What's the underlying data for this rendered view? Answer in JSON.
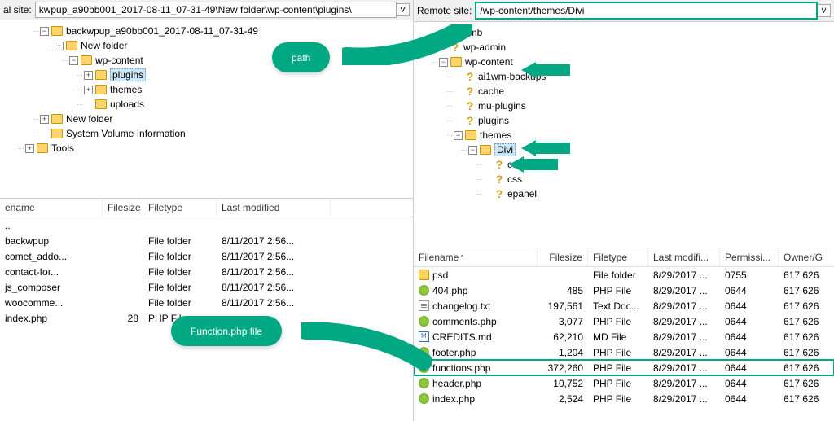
{
  "local": {
    "site_label": "al site:",
    "path": "kwpup_a90bb001_2017-08-11_07-31-49\\New folder\\wp-content\\plugins\\",
    "tree": [
      {
        "indent": 2,
        "toggle": "-",
        "icon": "folder",
        "label": "backwpup_a90bb001_2017-08-11_07-31-49"
      },
      {
        "indent": 3,
        "toggle": "-",
        "icon": "folder",
        "label": "New folder"
      },
      {
        "indent": 4,
        "toggle": "-",
        "icon": "folder",
        "label": "wp-content"
      },
      {
        "indent": 5,
        "toggle": "+",
        "icon": "folder",
        "label": "plugins",
        "selected": true
      },
      {
        "indent": 5,
        "toggle": "+",
        "icon": "folder",
        "label": "themes"
      },
      {
        "indent": 5,
        "toggle": "",
        "icon": "folder",
        "label": "uploads"
      },
      {
        "indent": 2,
        "toggle": "+",
        "icon": "folder",
        "label": "New folder"
      },
      {
        "indent": 2,
        "toggle": "",
        "icon": "folder",
        "label": "System Volume Information"
      },
      {
        "indent": 1,
        "toggle": "+",
        "icon": "folder",
        "label": "Tools"
      }
    ],
    "list_headers": {
      "name": "ename",
      "size": "Filesize",
      "type": "Filetype",
      "mod": "Last modified"
    },
    "files": [
      {
        "name": "..",
        "size": "",
        "type": "",
        "mod": ""
      },
      {
        "name": "backwpup",
        "size": "",
        "type": "File folder",
        "mod": "8/11/2017 2:56..."
      },
      {
        "name": "comet_addo...",
        "size": "",
        "type": "File folder",
        "mod": "8/11/2017 2:56..."
      },
      {
        "name": "contact-for...",
        "size": "",
        "type": "File folder",
        "mod": "8/11/2017 2:56..."
      },
      {
        "name": "js_composer",
        "size": "",
        "type": "File folder",
        "mod": "8/11/2017 2:56..."
      },
      {
        "name": "woocomme...",
        "size": "",
        "type": "File folder",
        "mod": "8/11/2017 2:56..."
      },
      {
        "name": "index.php",
        "size": "28",
        "type": "PHP File",
        "mod": ""
      }
    ]
  },
  "remote": {
    "site_label": "Remote site:",
    "path": "/wp-content/themes/Divi",
    "tree": [
      {
        "indent": 1,
        "toggle": "",
        "icon": "unknown",
        "label": ".tmb"
      },
      {
        "indent": 1,
        "toggle": "",
        "icon": "unknown",
        "label": "wp-admin"
      },
      {
        "indent": 1,
        "toggle": "-",
        "icon": "folder",
        "label": "wp-content"
      },
      {
        "indent": 2,
        "toggle": "",
        "icon": "unknown",
        "label": "ai1wm-backups"
      },
      {
        "indent": 2,
        "toggle": "",
        "icon": "unknown",
        "label": "cache"
      },
      {
        "indent": 2,
        "toggle": "",
        "icon": "unknown",
        "label": "mu-plugins"
      },
      {
        "indent": 2,
        "toggle": "",
        "icon": "unknown",
        "label": "plugins"
      },
      {
        "indent": 2,
        "toggle": "-",
        "icon": "folder",
        "label": "themes"
      },
      {
        "indent": 3,
        "toggle": "-",
        "icon": "folder",
        "label": "Divi",
        "selected": true
      },
      {
        "indent": 4,
        "toggle": "",
        "icon": "unknown",
        "label": "core"
      },
      {
        "indent": 4,
        "toggle": "",
        "icon": "unknown",
        "label": "css"
      },
      {
        "indent": 4,
        "toggle": "",
        "icon": "unknown",
        "label": "epanel"
      }
    ],
    "list_headers": {
      "name": "Filename",
      "size": "Filesize",
      "type": "Filetype",
      "mod": "Last modifi...",
      "perm": "Permissi...",
      "own": "Owner/G"
    },
    "files": [
      {
        "icon": "folder",
        "name": "psd",
        "size": "",
        "type": "File folder",
        "mod": "8/29/2017 ...",
        "perm": "0755",
        "own": "617 626"
      },
      {
        "icon": "php",
        "name": "404.php",
        "size": "485",
        "type": "PHP File",
        "mod": "8/29/2017 ...",
        "perm": "0644",
        "own": "617 626"
      },
      {
        "icon": "txt",
        "name": "changelog.txt",
        "size": "197,561",
        "type": "Text Doc...",
        "mod": "8/29/2017 ...",
        "perm": "0644",
        "own": "617 626"
      },
      {
        "icon": "php",
        "name": "comments.php",
        "size": "3,077",
        "type": "PHP File",
        "mod": "8/29/2017 ...",
        "perm": "0644",
        "own": "617 626"
      },
      {
        "icon": "md",
        "name": "CREDITS.md",
        "size": "62,210",
        "type": "MD File",
        "mod": "8/29/2017 ...",
        "perm": "0644",
        "own": "617 626"
      },
      {
        "icon": "php",
        "name": "footer.php",
        "size": "1,204",
        "type": "PHP File",
        "mod": "8/29/2017 ...",
        "perm": "0644",
        "own": "617 626"
      },
      {
        "icon": "php",
        "name": "functions.php",
        "size": "372,260",
        "type": "PHP File",
        "mod": "8/29/2017 ...",
        "perm": "0644",
        "own": "617 626",
        "highlight": true
      },
      {
        "icon": "php",
        "name": "header.php",
        "size": "10,752",
        "type": "PHP File",
        "mod": "8/29/2017 ...",
        "perm": "0644",
        "own": "617 626"
      },
      {
        "icon": "php",
        "name": "index.php",
        "size": "2,524",
        "type": "PHP File",
        "mod": "8/29/2017 ...",
        "perm": "0644",
        "own": "617 626"
      }
    ]
  },
  "callouts": {
    "path": "path",
    "functions": "Function.php file"
  }
}
